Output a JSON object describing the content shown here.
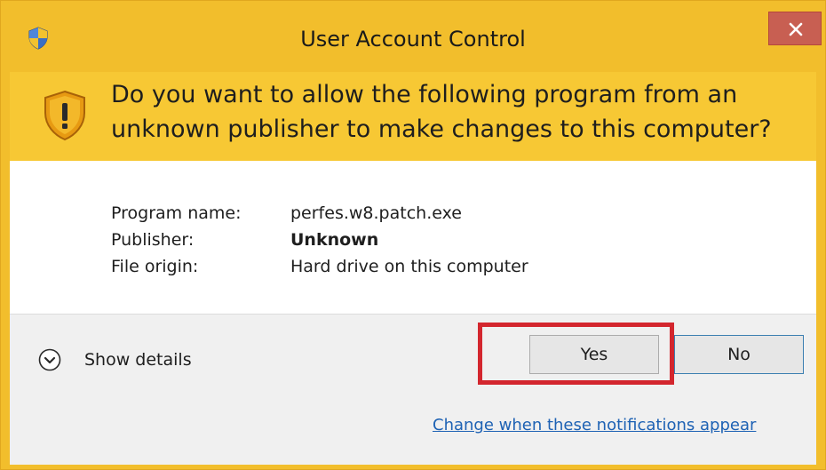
{
  "window": {
    "title": "User Account Control",
    "close_label": "×"
  },
  "banner": {
    "question": "Do you want to allow the following program from an unknown publisher to make changes to this computer?"
  },
  "info": {
    "program_name_label": "Program name:",
    "program_name_value": "perfes.w8.patch.exe",
    "publisher_label": "Publisher:",
    "publisher_value": "Unknown",
    "file_origin_label": "File origin:",
    "file_origin_value": "Hard drive on this computer"
  },
  "footer": {
    "show_details_label": "Show details",
    "yes_label": "Yes",
    "no_label": "No",
    "notifications_link": "Change when these notifications appear"
  },
  "colors": {
    "title_bar": "#f2be2c",
    "banner": "#f7c834",
    "close_button": "#c85f52",
    "highlight": "#d3262e",
    "link": "#1e62b4"
  },
  "icons": {
    "title": "uac-shield-icon",
    "banner": "warning-shield-icon",
    "details": "chevron-down-circle-icon",
    "close": "close-icon"
  }
}
